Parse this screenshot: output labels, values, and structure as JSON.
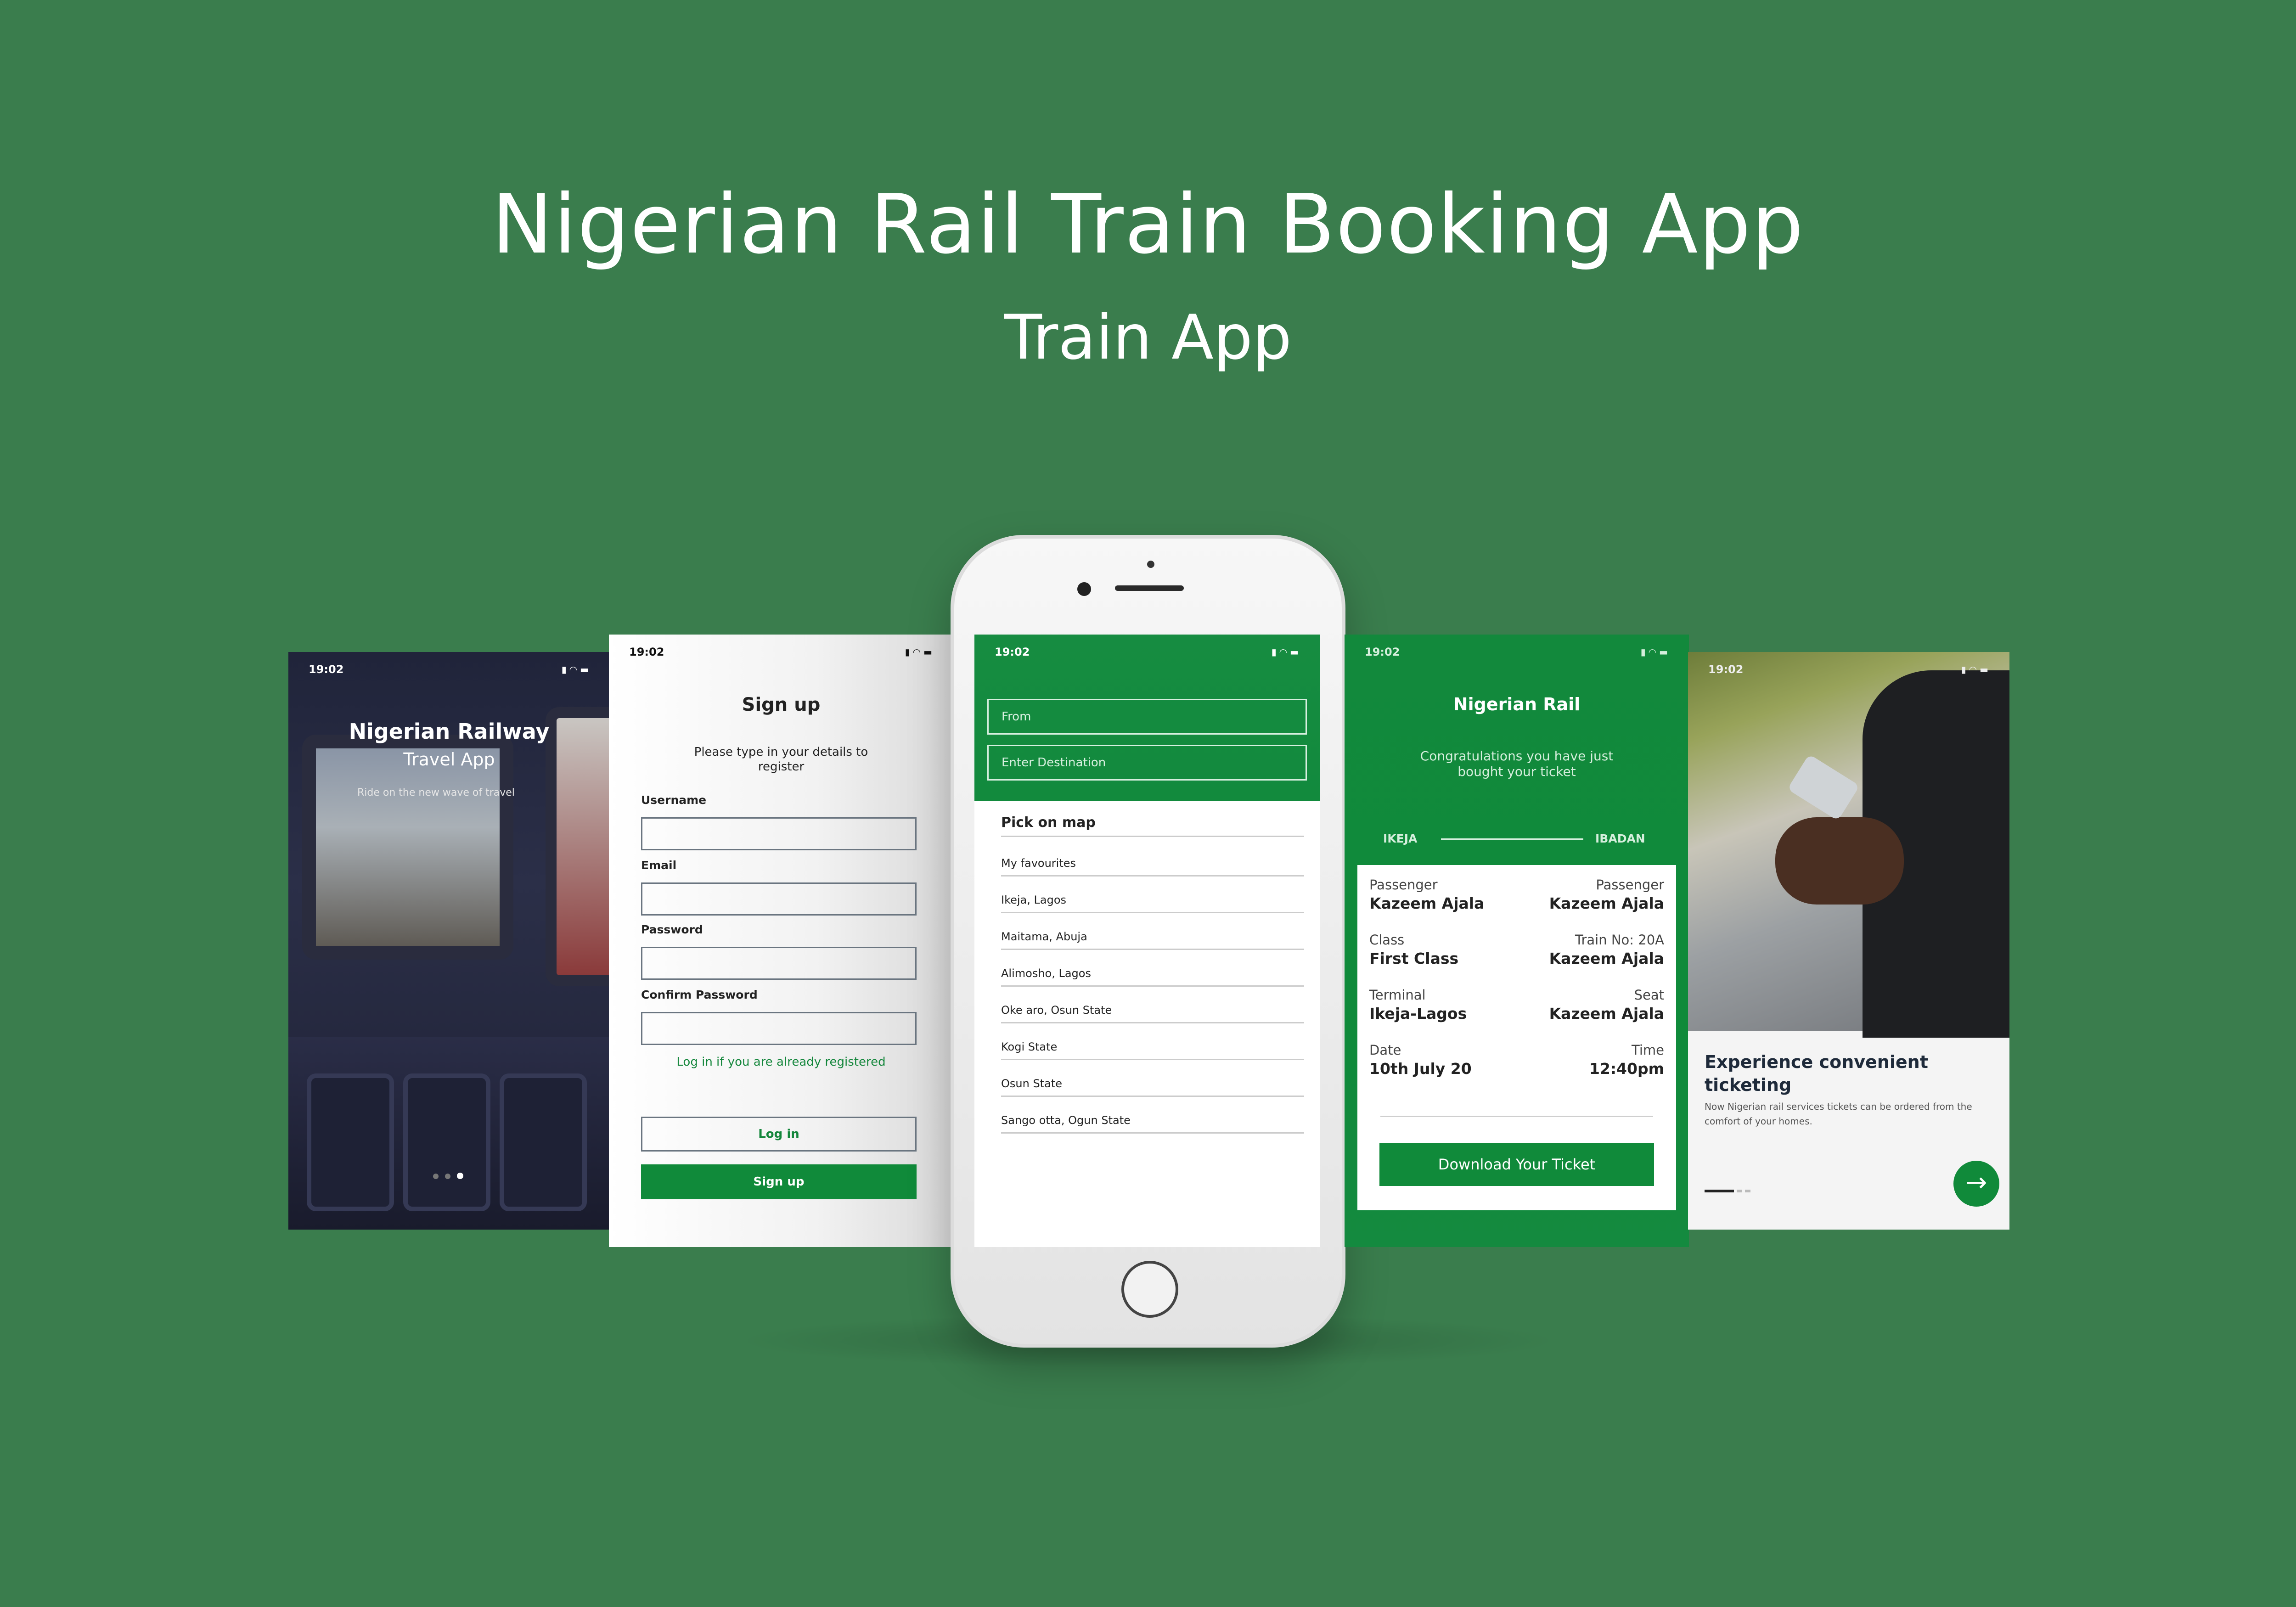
{
  "header": {
    "title": "Nigerian Rail Train Booking App",
    "subtitle": "Train App"
  },
  "colors": {
    "background": "#3a7d4d",
    "brand_green": "#108a3a",
    "white": "#ffffff"
  },
  "status_bar": {
    "time": "19:02",
    "icons": [
      "signal-icon",
      "wifi-icon",
      "battery-icon"
    ]
  },
  "onboarding": {
    "title": "Nigerian Railway",
    "subtitle": "Travel App",
    "tagline": "Ride on the new wave of travel",
    "page_count": 3,
    "active_page": 3
  },
  "signup": {
    "heading": "Sign up",
    "hint": "Please type in your details to register",
    "fields": [
      {
        "label": "Username",
        "value": ""
      },
      {
        "label": "Email",
        "value": ""
      },
      {
        "label": "Password",
        "value": ""
      },
      {
        "label": "Confirm Password",
        "value": ""
      }
    ],
    "login_link": "Log in if you are already registered",
    "login_button": "Log in",
    "signup_button": "Sign up"
  },
  "search": {
    "from_placeholder": "From",
    "destination_placeholder": "Enter Destination",
    "pick_on_map": "Pick on map",
    "locations": [
      "My favourites",
      "Ikeja, Lagos",
      "Maitama, Abuja",
      "Alimosho, Lagos",
      "Oke aro, Osun State",
      "Kogi State",
      "Osun State",
      "Sango otta, Ogun State"
    ]
  },
  "ticket": {
    "heading": "Nigerian Rail",
    "congrats": "Congratulations you have just bought your ticket",
    "origin": "IKEJA",
    "destination": "IBADAN",
    "rows": [
      {
        "left_key": "Passenger",
        "left_val": "Kazeem Ajala",
        "right_key": "Passenger",
        "right_val": "Kazeem Ajala"
      },
      {
        "left_key": "Class",
        "left_val": "First Class",
        "right_key": "Train No: 20A",
        "right_val": "Kazeem Ajala"
      },
      {
        "left_key": "Terminal",
        "left_val": "Ikeja-Lagos",
        "right_key": "Seat",
        "right_val": "Kazeem Ajala"
      },
      {
        "left_key": "Date",
        "left_val": "10th July 20",
        "right_key": "Time",
        "right_val": "12:40pm"
      }
    ],
    "download_button": "Download Your Ticket"
  },
  "experience": {
    "heading": "Experience convenient ticketing",
    "description": "Now Nigerian rail services tickets can be ordered from the comfort of your homes.",
    "next_icon": "arrow-right-icon"
  }
}
